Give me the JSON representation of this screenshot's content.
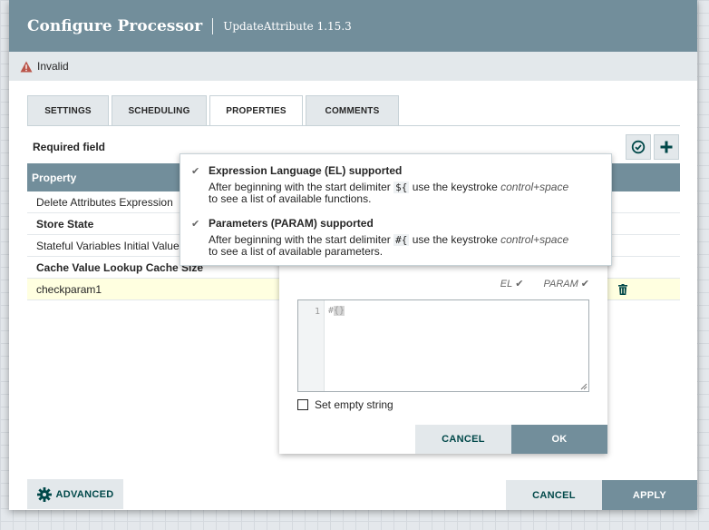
{
  "dialog": {
    "title": "Configure Processor",
    "subtitle": "UpdateAttribute 1.15.3",
    "status": "Invalid"
  },
  "tabs": [
    {
      "label": "SETTINGS"
    },
    {
      "label": "SCHEDULING"
    },
    {
      "label": "PROPERTIES"
    },
    {
      "label": "COMMENTS"
    }
  ],
  "properties": {
    "required_label": "Required field",
    "header": "Property",
    "rows": [
      {
        "name": "Delete Attributes Expression"
      },
      {
        "name": "Store State"
      },
      {
        "name": "Stateful Variables Initial Value"
      },
      {
        "name": "Cache Value Lookup Cache Size"
      },
      {
        "name": "checkparam1"
      }
    ]
  },
  "tooltip": {
    "el_heading": "Expression Language (EL) supported",
    "el_text_1": "After beginning with the start delimiter",
    "el_delim": "${",
    "el_text_2": "use the keystroke",
    "el_keystroke": "control+space",
    "el_text_3": "to see a list of available functions.",
    "param_heading": "Parameters (PARAM) supported",
    "param_text_1": "After beginning with the start delimiter",
    "param_delim": "#{",
    "param_text_2": "use the keystroke",
    "param_keystroke": "control+space",
    "param_text_3": "to see a list of available parameters."
  },
  "editor": {
    "el_flag": "EL",
    "param_flag": "PARAM",
    "line_number": "1",
    "code_prefix": "#",
    "code_braces": "{}",
    "empty_string_label": "Set empty string",
    "cancel": "CANCEL",
    "ok": "OK"
  },
  "footer": {
    "advanced": "ADVANCED",
    "cancel": "CANCEL",
    "apply": "APPLY"
  },
  "colors": {
    "header": "#728e9b",
    "light": "#e3e8eb",
    "accent_text": "#004849",
    "warning": "#ba554a"
  }
}
